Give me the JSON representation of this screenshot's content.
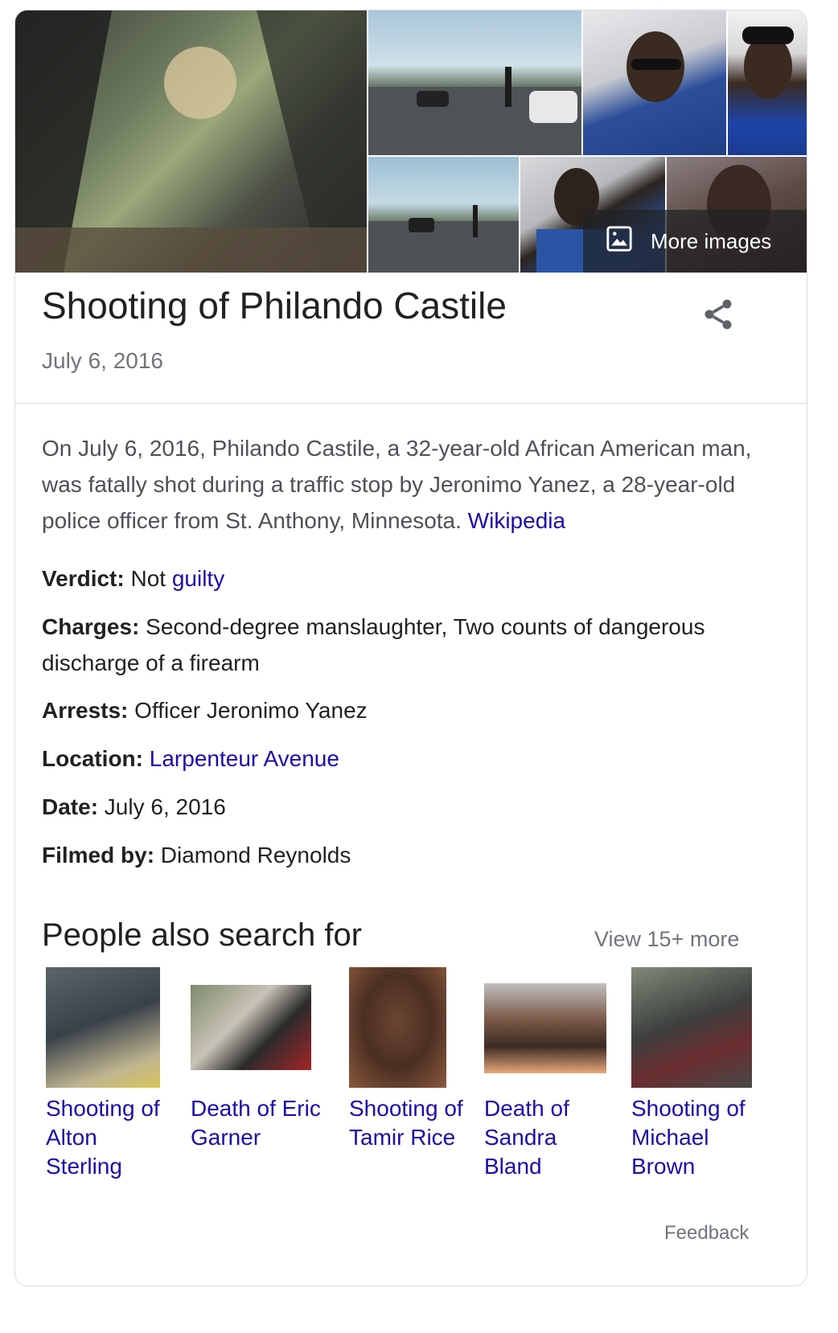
{
  "header": {
    "title": "Shooting of Philando Castile",
    "subtitle": "July 6, 2016",
    "more_images_label": "More images"
  },
  "description": {
    "text": "On July 6, 2016, Philando Castile, a 32-year-old African American man, was fatally shot during a traffic stop by Jeronimo Yanez, a 28-year-old police officer from St. Anthony, Minnesota.",
    "source": "Wikipedia"
  },
  "facts": {
    "verdict": {
      "label": "Verdict:",
      "prefix": "Not",
      "link": "guilty"
    },
    "charges": {
      "label": "Charges:",
      "value": "Second-degree manslaughter, Two counts of dangerous discharge of a firearm"
    },
    "arrests": {
      "label": "Arrests:",
      "value": "Officer Jeronimo Yanez"
    },
    "location": {
      "label": "Location:",
      "link": "Larpenteur Avenue"
    },
    "date": {
      "label": "Date:",
      "value": "July 6, 2016"
    },
    "filmed_by": {
      "label": "Filmed by:",
      "value": "Diamond Reynolds"
    }
  },
  "people_also_search": {
    "title": "People also search for",
    "view_more": "View 15+ more",
    "items": [
      {
        "label": "Shooting of Alton Sterling"
      },
      {
        "label": "Death of Eric Garner"
      },
      {
        "label": "Shooting of Tamir Rice"
      },
      {
        "label": "Death of Sandra Bland"
      },
      {
        "label": "Shooting of Michael Brown"
      }
    ]
  },
  "footer": {
    "feedback": "Feedback"
  },
  "icons": {
    "share": "share-icon",
    "image": "image-icon"
  },
  "colors": {
    "link": "#1a0dab",
    "muted": "#70757a",
    "text": "#202124",
    "border": "#dadce0"
  }
}
